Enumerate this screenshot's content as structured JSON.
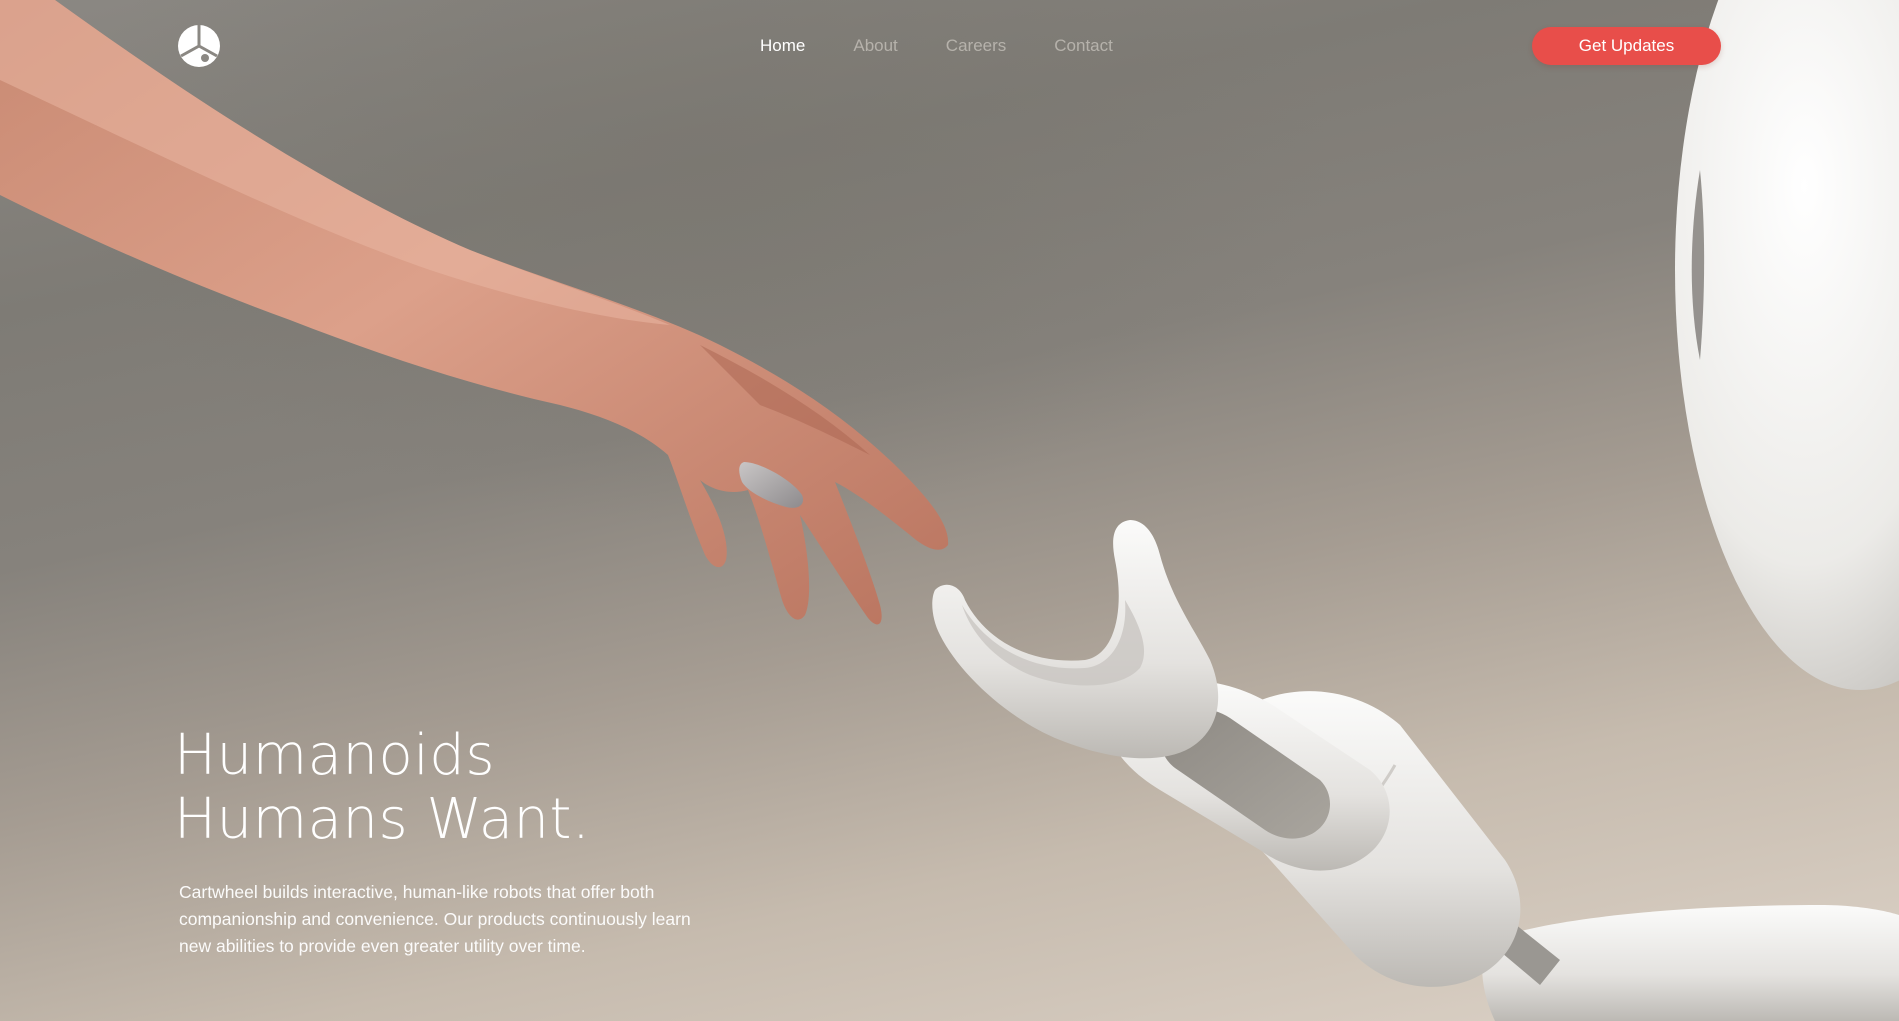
{
  "brand": {
    "logo_icon": "cartwheel-logo-icon"
  },
  "nav": {
    "items": [
      {
        "label": "Home",
        "active": true
      },
      {
        "label": "About",
        "active": false
      },
      {
        "label": "Careers",
        "active": false
      },
      {
        "label": "Contact",
        "active": false
      }
    ]
  },
  "cta": {
    "label": "Get Updates",
    "color": "#e84e4a"
  },
  "hero": {
    "headline_line1": "Humanoids",
    "headline_line2": "Humans Want.",
    "description": "Cartwheel builds interactive, human-like robots that offer both companionship and convenience. Our products continuously learn new abilities to provide even greater utility over time.",
    "image_subject": "human-hand-reaching-robot-hand"
  },
  "colors": {
    "background_top": "#8b8883",
    "background_bottom": "#ddd3c8",
    "skin": "#d99b82",
    "robot_white": "#eeecea",
    "nav_inactive": "#c8c4be"
  }
}
